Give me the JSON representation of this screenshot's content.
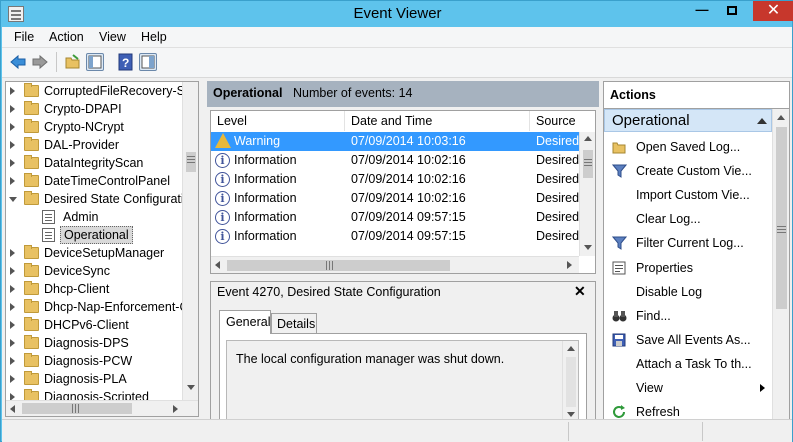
{
  "window": {
    "title": "Event Viewer",
    "minimize": "—",
    "maximize": "☐",
    "close": "✕"
  },
  "menu": [
    "File",
    "Action",
    "View",
    "Help"
  ],
  "toolbar": {
    "icons": [
      "back-arrow-icon",
      "forward-arrow-icon",
      "open-folder-icon",
      "show-hide-console-tree-icon",
      "help-icon",
      "show-hide-action-pane-icon"
    ]
  },
  "tree": {
    "items": [
      {
        "label": "CorruptedFileRecovery-Ser",
        "expanded": false,
        "level": 0
      },
      {
        "label": "Crypto-DPAPI",
        "expanded": false,
        "level": 0
      },
      {
        "label": "Crypto-NCrypt",
        "expanded": false,
        "level": 0
      },
      {
        "label": "DAL-Provider",
        "expanded": false,
        "level": 0
      },
      {
        "label": "DataIntegrityScan",
        "expanded": false,
        "level": 0
      },
      {
        "label": "DateTimeControlPanel",
        "expanded": false,
        "level": 0
      },
      {
        "label": "Desired State Configuration",
        "expanded": true,
        "level": 0
      },
      {
        "label": "Admin",
        "level": 1
      },
      {
        "label": "Operational",
        "level": 1,
        "selected": true
      },
      {
        "label": "DeviceSetupManager",
        "expanded": false,
        "level": 0
      },
      {
        "label": "DeviceSync",
        "expanded": false,
        "level": 0
      },
      {
        "label": "Dhcp-Client",
        "expanded": false,
        "level": 0
      },
      {
        "label": "Dhcp-Nap-Enforcement-C",
        "expanded": false,
        "level": 0
      },
      {
        "label": "DHCPv6-Client",
        "expanded": false,
        "level": 0
      },
      {
        "label": "Diagnosis-DPS",
        "expanded": false,
        "level": 0
      },
      {
        "label": "Diagnosis-PCW",
        "expanded": false,
        "level": 0
      },
      {
        "label": "Diagnosis-PLA",
        "expanded": false,
        "level": 0
      },
      {
        "label": "Diagnosis-Scripted",
        "expanded": false,
        "level": 0
      }
    ]
  },
  "events_header": {
    "title": "Operational",
    "count_label": "Number of events: 14"
  },
  "events_table": {
    "columns": [
      "Level",
      "Date and Time",
      "Source"
    ],
    "rows": [
      {
        "level": "Warning",
        "datetime": "07/09/2014 10:03:16",
        "source": "Desired",
        "icon": "warning-icon",
        "selected": true
      },
      {
        "level": "Information",
        "datetime": "07/09/2014 10:02:16",
        "source": "Desired",
        "icon": "info-icon"
      },
      {
        "level": "Information",
        "datetime": "07/09/2014 10:02:16",
        "source": "Desired",
        "icon": "info-icon"
      },
      {
        "level": "Information",
        "datetime": "07/09/2014 10:02:16",
        "source": "Desired",
        "icon": "info-icon"
      },
      {
        "level": "Information",
        "datetime": "07/09/2014 09:57:15",
        "source": "Desired",
        "icon": "info-icon"
      },
      {
        "level": "Information",
        "datetime": "07/09/2014 09:57:15",
        "source": "Desired",
        "icon": "info-icon"
      }
    ]
  },
  "detail": {
    "title": "Event 4270, Desired State Configuration",
    "tabs": [
      "General",
      "Details"
    ],
    "message": "The local configuration manager was shut down."
  },
  "actions": {
    "header": "Actions",
    "section": "Operational",
    "items": [
      {
        "label": "Open Saved Log...",
        "icon": "open-folder-icon"
      },
      {
        "label": "Create Custom Vie...",
        "icon": "filter-icon"
      },
      {
        "label": "Import Custom Vie...",
        "icon": ""
      },
      {
        "label": "Clear Log...",
        "icon": ""
      },
      {
        "label": "Filter Current Log...",
        "icon": "filter-icon"
      },
      {
        "label": "Properties",
        "icon": "properties-icon"
      },
      {
        "label": "Disable Log",
        "icon": ""
      },
      {
        "label": "Find...",
        "icon": "binoculars-icon"
      },
      {
        "label": "Save All Events As...",
        "icon": "save-icon"
      },
      {
        "label": "Attach a Task To th...",
        "icon": ""
      },
      {
        "label": "View",
        "icon": "",
        "submenu": true
      },
      {
        "label": "Refresh",
        "icon": "refresh-icon"
      }
    ]
  },
  "colors": {
    "titlebar": "#5ec3ec",
    "close": "#c7372c",
    "selection": "#3399ff",
    "pane_header": "#a6b2bf",
    "action_section": "#d4e6f7"
  }
}
